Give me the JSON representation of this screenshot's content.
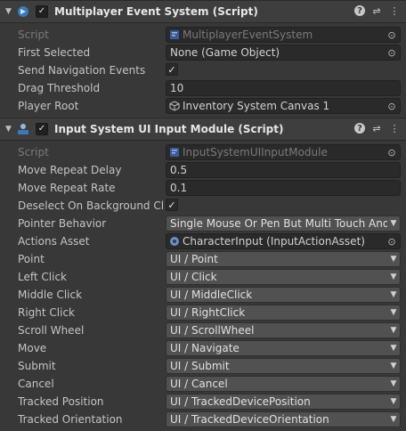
{
  "components": [
    {
      "title": "Multiplayer Event System (Script)",
      "enabled": true,
      "rows": [
        {
          "label": "Script",
          "type": "object",
          "value": "MultiplayerEventSystem",
          "icon": "script-icon",
          "disabled": true
        },
        {
          "label": "First Selected",
          "type": "object",
          "value": "None (Game Object)",
          "icon": ""
        },
        {
          "label": "Send Navigation Events",
          "type": "checkbox",
          "checked": true
        },
        {
          "label": "Drag Threshold",
          "type": "text",
          "value": "10"
        },
        {
          "label": "Player Root",
          "type": "object",
          "value": "Inventory System Canvas 1",
          "icon": "gameobject-icon"
        }
      ]
    },
    {
      "title": "Input System UI Input Module (Script)",
      "enabled": true,
      "rows": [
        {
          "label": "Script",
          "type": "object",
          "value": "InputSystemUIInputModule",
          "icon": "script-icon",
          "disabled": true
        },
        {
          "label": "Move Repeat Delay",
          "type": "text",
          "value": "0.5"
        },
        {
          "label": "Move Repeat Rate",
          "type": "text",
          "value": "0.1"
        },
        {
          "label": "Deselect On Background Click",
          "type": "checkbox",
          "checked": true
        },
        {
          "label": "Pointer Behavior",
          "type": "dropdown",
          "value": "Single Mouse Or Pen But Multi Touch And Track"
        },
        {
          "label": "Actions Asset",
          "type": "object",
          "value": "CharacterInput (InputActionAsset)",
          "icon": "input-asset-icon"
        },
        {
          "label": "Point",
          "type": "dropdown",
          "value": "UI / Point"
        },
        {
          "label": "Left Click",
          "type": "dropdown",
          "value": "UI / Click"
        },
        {
          "label": "Middle Click",
          "type": "dropdown",
          "value": "UI / MiddleClick"
        },
        {
          "label": "Right Click",
          "type": "dropdown",
          "value": "UI / RightClick"
        },
        {
          "label": "Scroll Wheel",
          "type": "dropdown",
          "value": "UI / ScrollWheel"
        },
        {
          "label": "Move",
          "type": "dropdown",
          "value": "UI / Navigate"
        },
        {
          "label": "Submit",
          "type": "dropdown",
          "value": "UI / Submit"
        },
        {
          "label": "Cancel",
          "type": "dropdown",
          "value": "UI / Cancel"
        },
        {
          "label": "Tracked Position",
          "type": "dropdown",
          "value": "UI / TrackedDevicePosition"
        },
        {
          "label": "Tracked Orientation",
          "type": "dropdown",
          "value": "UI / TrackedDeviceOrientation"
        }
      ]
    }
  ],
  "icons": {
    "fold": "chevron-down-icon",
    "help": "help-icon",
    "presets": "presets-icon",
    "menu": "more-vertical-icon",
    "picker": "object-picker-icon"
  },
  "colors": {
    "accent": "#3a79bb",
    "panel": "#383838",
    "field": "#2a2a2a",
    "dropdown": "#515151"
  }
}
